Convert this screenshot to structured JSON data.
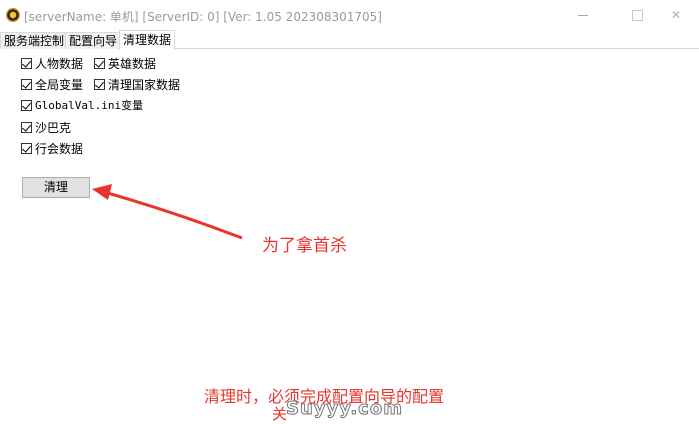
{
  "window": {
    "title": "[serverName: 单机] [ServerID: 0] [Ver:  1.05 202308301705]",
    "min_icon": "minimize-icon",
    "max_icon": "maximize-icon",
    "close_icon": "close-icon"
  },
  "tabs": [
    {
      "label": "服务端控制"
    },
    {
      "label": "配置向导"
    },
    {
      "label": "清理数据",
      "selected": true
    }
  ],
  "options": {
    "character": {
      "label": "人物数据",
      "checked": true
    },
    "hero": {
      "label": "英雄数据",
      "checked": true
    },
    "global_var": {
      "label": "全局变量",
      "checked": true
    },
    "nation": {
      "label": "清理国家数据",
      "checked": true
    },
    "globalval_ini": {
      "label": "GlobalVal.ini变量",
      "checked": true
    },
    "sabak": {
      "label": "沙巴克",
      "checked": true
    },
    "guild": {
      "label": "行会数据",
      "checked": true
    }
  },
  "clean_button": "清理",
  "annotations": {
    "note1": "为了拿首杀",
    "note2": "清理时，必须完成配置向导的配置",
    "note3": "关",
    "watermark": "Suyyy.com",
    "accent_color": "#e8342b"
  }
}
